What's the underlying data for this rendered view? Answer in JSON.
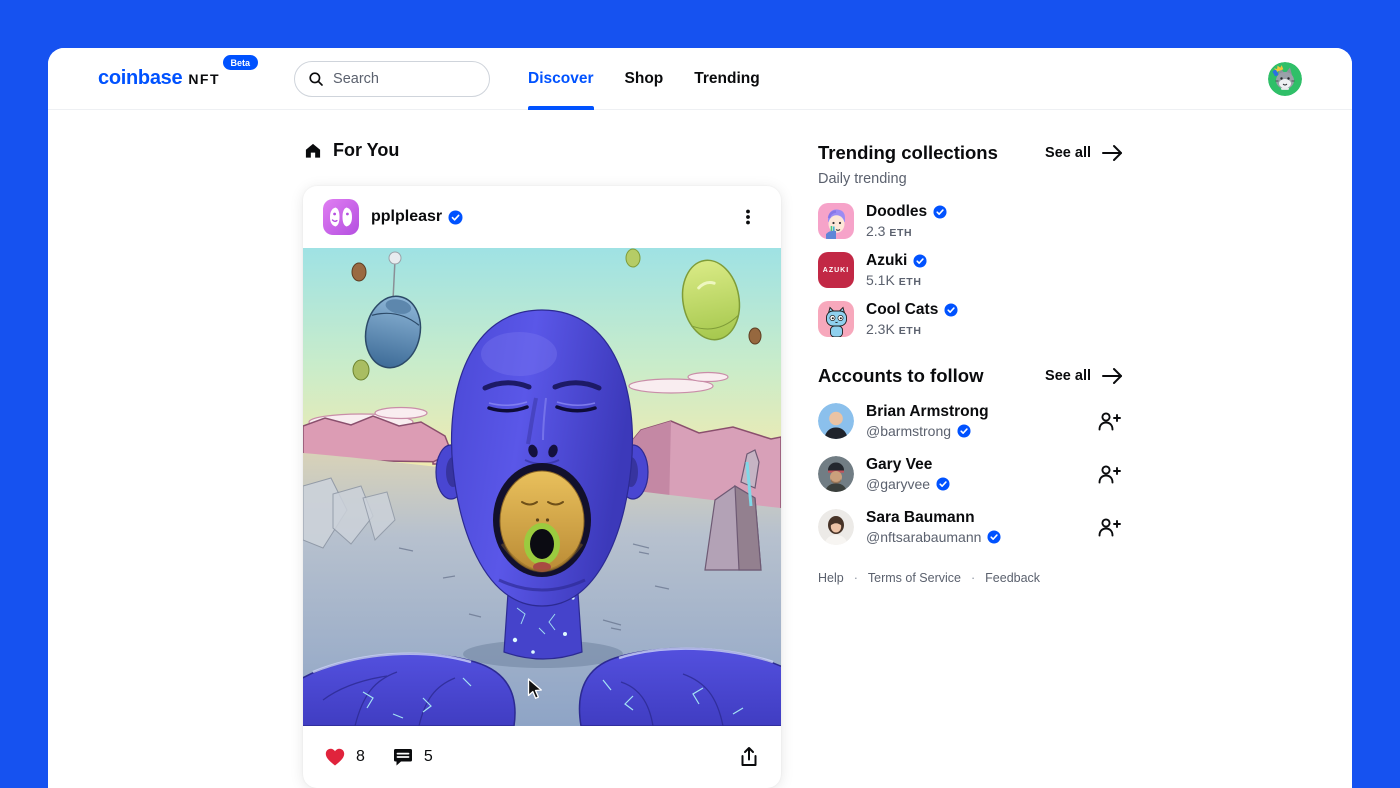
{
  "colors": {
    "brand": "#0052ff",
    "background": "#1652f0",
    "text": "#0a0b0d",
    "muted": "#5b616e",
    "heart_red": "#e0233c"
  },
  "header": {
    "logo": "coinbase",
    "logo_product": "NFT",
    "beta_badge": "Beta",
    "search": {
      "placeholder": "Search"
    },
    "tabs": [
      {
        "label": "Discover",
        "active": true
      },
      {
        "label": "Shop",
        "active": false
      },
      {
        "label": "Trending",
        "active": false
      }
    ]
  },
  "feed": {
    "section_title": "For You",
    "post": {
      "author": "pplpleasr",
      "verified": true,
      "likes": "8",
      "comments": "5"
    }
  },
  "sidebar": {
    "trending": {
      "title": "Trending collections",
      "subtitle": "Daily trending",
      "see_all": "See all",
      "items": [
        {
          "name": "Doodles",
          "verified": true,
          "value": "2.3",
          "unit": "ETH"
        },
        {
          "name": "Azuki",
          "verified": true,
          "value": "5.1K",
          "unit": "ETH",
          "avatar_text": "AZUKI"
        },
        {
          "name": "Cool Cats",
          "verified": true,
          "value": "2.3K",
          "unit": "ETH"
        }
      ]
    },
    "accounts": {
      "title": "Accounts to follow",
      "see_all": "See all",
      "items": [
        {
          "name": "Brian Armstrong",
          "handle": "@barmstrong",
          "verified": true
        },
        {
          "name": "Gary Vee",
          "handle": "@garyvee",
          "verified": true
        },
        {
          "name": "Sara Baumann",
          "handle": "@nftsarabaumann",
          "verified": true
        }
      ]
    },
    "footer_links": [
      "Help",
      "Terms of Service",
      "Feedback"
    ]
  }
}
